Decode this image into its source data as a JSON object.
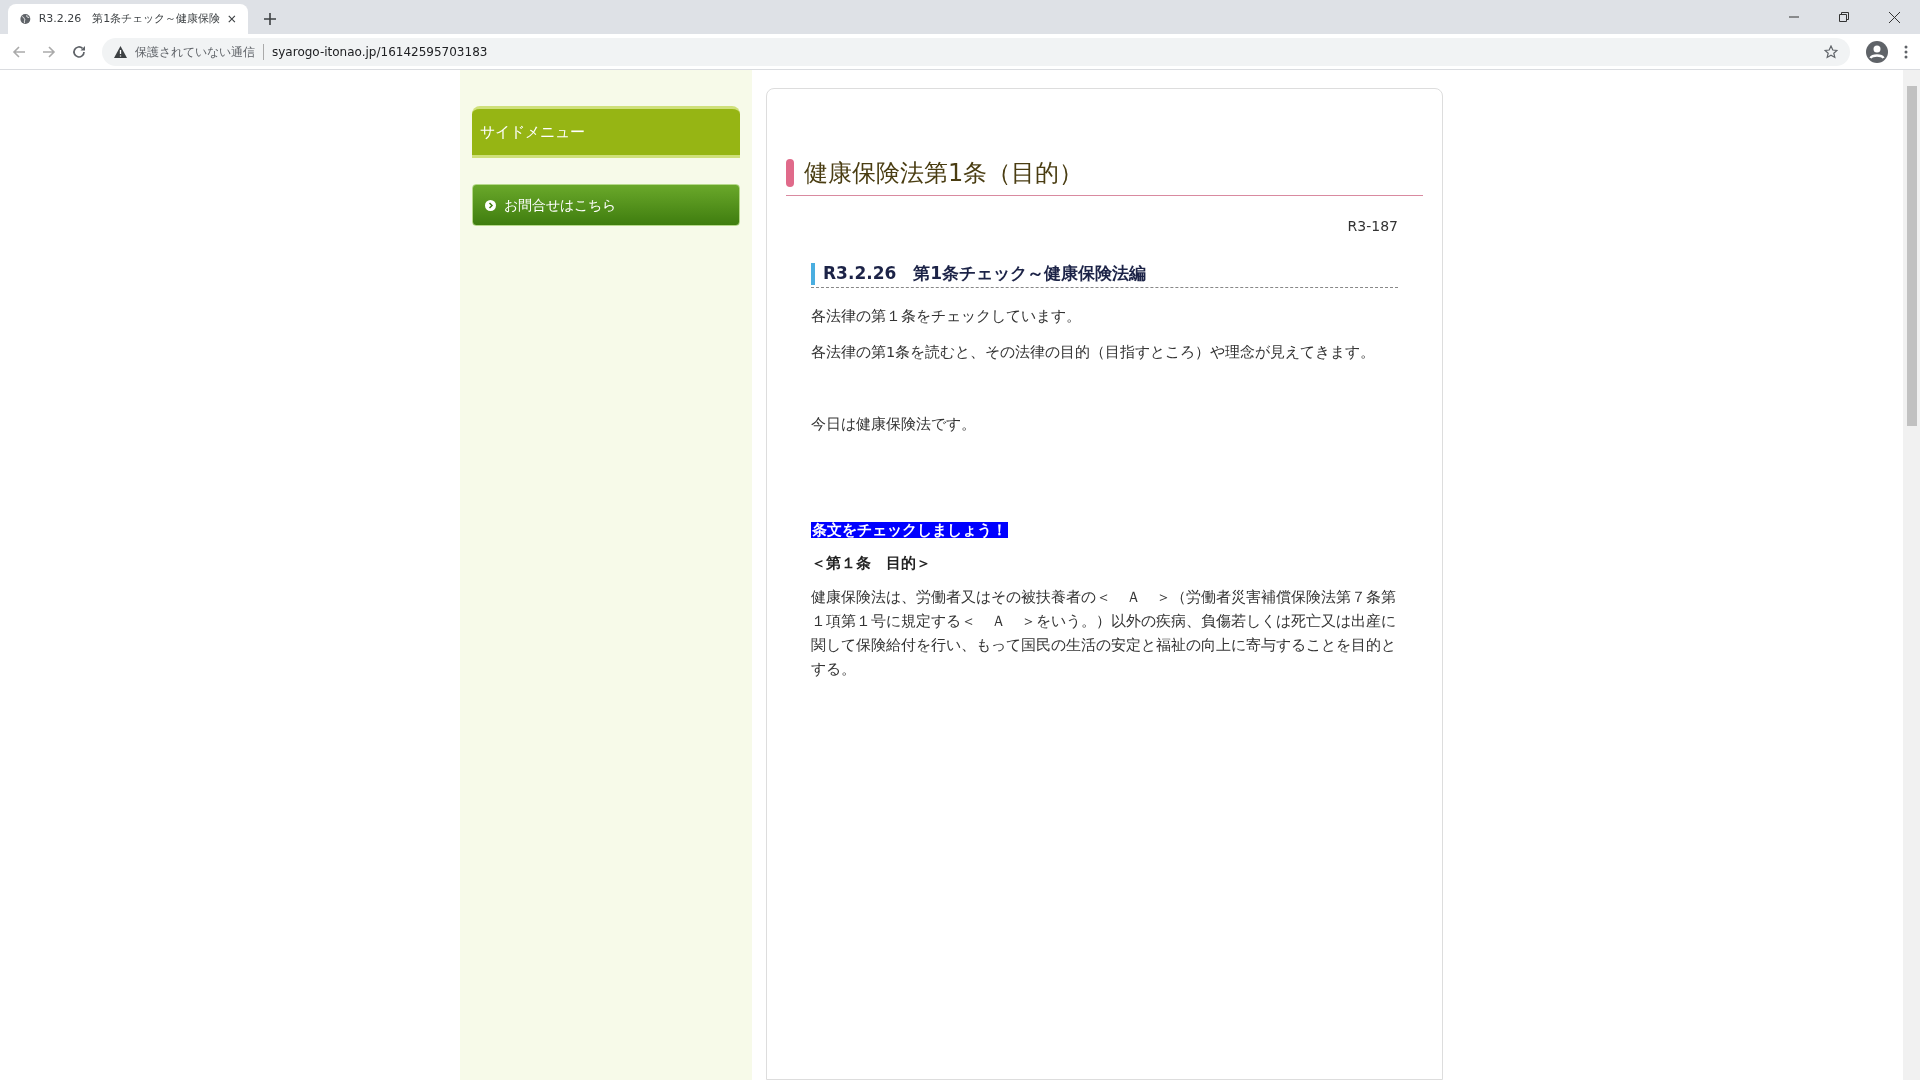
{
  "browser": {
    "tab": {
      "title": "R3.2.26　第1条チェック～健康保険",
      "selected": true
    },
    "address": {
      "security": "保護されていない通信",
      "url": "syarogo-itonao.jp/16142595703183"
    }
  },
  "sidebar": {
    "title": "サイドメニュー",
    "items": [
      {
        "label": "お問合せはこちら"
      }
    ]
  },
  "article": {
    "title": "健康保険法第1条（目的）",
    "code": "R3-187",
    "subtitle": "R3.2.26　第1条チェック～健康保険法編",
    "blocks": [
      {
        "kind": "text",
        "text": "各法律の第１条をチェックしています。"
      },
      {
        "kind": "text",
        "text": "各法律の第1条を読むと、その法律の目的（目指すところ）や理念が見えてきます。"
      },
      {
        "kind": "gap"
      },
      {
        "kind": "text",
        "text": "今日は健康保険法です。"
      },
      {
        "kind": "gap"
      },
      {
        "kind": "gap"
      },
      {
        "kind": "highlight",
        "text": "条文をチェックしましょう！"
      },
      {
        "kind": "bold",
        "text": "＜第１条　目的＞"
      },
      {
        "kind": "text",
        "text": "健康保険法は、労働者又はその被扶養者の＜　Ａ　＞（労働者災害補償保険法第７条第１項第１号に規定する＜　Ａ　＞をいう。）以外の疾病、負傷若しくは死亡又は出産に関して保険給付を行い、もって国民の生活の安定と福祉の向上に寄与することを目的とする。"
      }
    ]
  }
}
